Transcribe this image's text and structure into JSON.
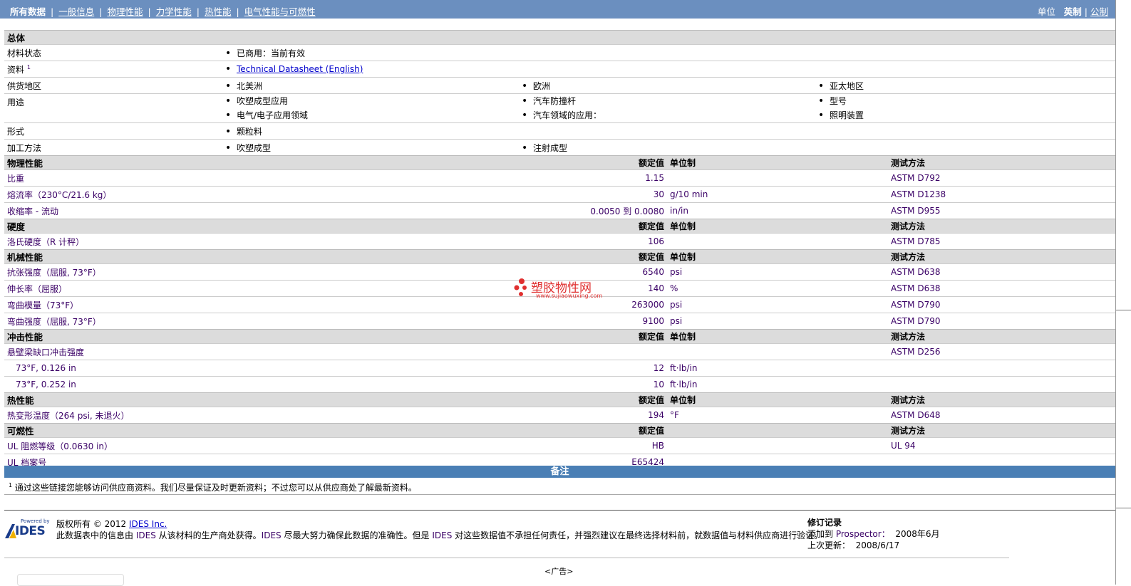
{
  "nav": {
    "items": [
      "所有数据",
      "一般信息",
      "物理性能",
      "力学性能",
      "热性能",
      "电气性能与可燃性"
    ],
    "units_label": "单位",
    "unit_english": "英制",
    "unit_metric": "公制"
  },
  "general": {
    "title": "总体",
    "material_status_label": "材料状态",
    "material_status_value": "已商用：当前有效",
    "docs_label": "资料",
    "docs_sup": "1",
    "docs_link": "Technical Datasheet (English)",
    "supply_label": "供货地区",
    "supply": [
      "北美洲",
      "欧洲",
      "亚太地区"
    ],
    "uses_label": "用途",
    "uses": [
      [
        "吹塑成型应用",
        "电气/电子应用领域"
      ],
      [
        "汽车防撞杆",
        "汽车领域的应用："
      ],
      [
        "型号",
        "照明装置"
      ]
    ],
    "form_label": "形式",
    "form": "颗粒料",
    "process_label": "加工方法",
    "process": [
      "吹塑成型",
      "注射成型"
    ]
  },
  "headers": {
    "nominal": "额定值",
    "unit": "单位制",
    "test": "测试方法"
  },
  "physical": {
    "title": "物理性能",
    "rows": [
      {
        "name": "比重",
        "value": "1.15",
        "unit": "",
        "test": "ASTM D792"
      },
      {
        "name": "熔流率（230°C/21.6 kg）",
        "value": "30",
        "unit": "g/10 min",
        "test": "ASTM D1238"
      },
      {
        "name": "收缩率 - 流动",
        "value": "0.0050 到  0.0080",
        "unit": "in/in",
        "test": "ASTM D955"
      }
    ]
  },
  "hardness": {
    "title": "硬度",
    "rows": [
      {
        "name": "洛氏硬度（R 计秤）",
        "value": "106",
        "unit": "",
        "test": "ASTM D785"
      }
    ]
  },
  "mechanical": {
    "title": "机械性能",
    "rows": [
      {
        "name": "抗张强度（屈服, 73°F）",
        "value": "6540",
        "unit": "psi",
        "test": "ASTM D638"
      },
      {
        "name": "伸长率（屈服）",
        "value": "140",
        "unit": "%",
        "test": "ASTM D638"
      },
      {
        "name": "弯曲模量（73°F）",
        "value": "263000",
        "unit": "psi",
        "test": "ASTM D790"
      },
      {
        "name": "弯曲强度（屈服, 73°F）",
        "value": "9100",
        "unit": "psi",
        "test": "ASTM D790"
      }
    ]
  },
  "impact": {
    "title": "冲击性能",
    "main_name": "悬壁梁缺口冲击强度",
    "main_test": "ASTM D256",
    "rows": [
      {
        "name": "73°F, 0.126 in",
        "value": "12",
        "unit": "ft·lb/in"
      },
      {
        "name": "73°F, 0.252 in",
        "value": "10",
        "unit": "ft·lb/in"
      }
    ]
  },
  "thermal": {
    "title": "热性能",
    "rows": [
      {
        "name": "热变形温度（264 psi, 未退火）",
        "value": "194",
        "unit": "°F",
        "test": "ASTM D648"
      }
    ]
  },
  "flammability": {
    "title": "可燃性",
    "rows": [
      {
        "name": "UL 阻燃等级（0.0630 in）",
        "value": "HB",
        "test": "UL 94"
      },
      {
        "name": "UL 档案号",
        "value": "E65424",
        "test": ""
      }
    ]
  },
  "notes": {
    "title": "备注",
    "sup": "1",
    "text": "通过这些链接您能够访问供应商资料。我们尽量保证及时更新资料；不过您可以从供应商处了解最新资料。"
  },
  "footer": {
    "logo_powered": "Powered by",
    "logo_name": "IDES",
    "copyright": "版权所有 © 2012",
    "ides_link": "IDES Inc.",
    "disclaimer_parts": [
      "此数据表中的信息由",
      "IDES",
      "从该材料的生产商处获得。",
      "IDES",
      "尽最大努力确保此数据的准确性。但是",
      "IDES",
      "对这些数据值不承担任何责任，并强烈建议在最终选择材料前，就数据值与材料供应商进行验证。"
    ],
    "rev_title": "修订记录",
    "added_label": "添加到",
    "added_prospector": "Prospector：",
    "added_date": "2008年6月",
    "updated_label": "上次更新：",
    "updated_date": "2008/6/17",
    "ad": "<广告>"
  },
  "watermark": {
    "text": "塑胶物性网",
    "url": "www.sujiaowuxing.com"
  },
  "colors": {
    "topbar": "#6b8fbf",
    "banner": "#4a7fb5",
    "section_bg": "#dcdcdc",
    "property_text": "#3a0066",
    "link": "#0000cc",
    "watermark": "#e03030"
  }
}
